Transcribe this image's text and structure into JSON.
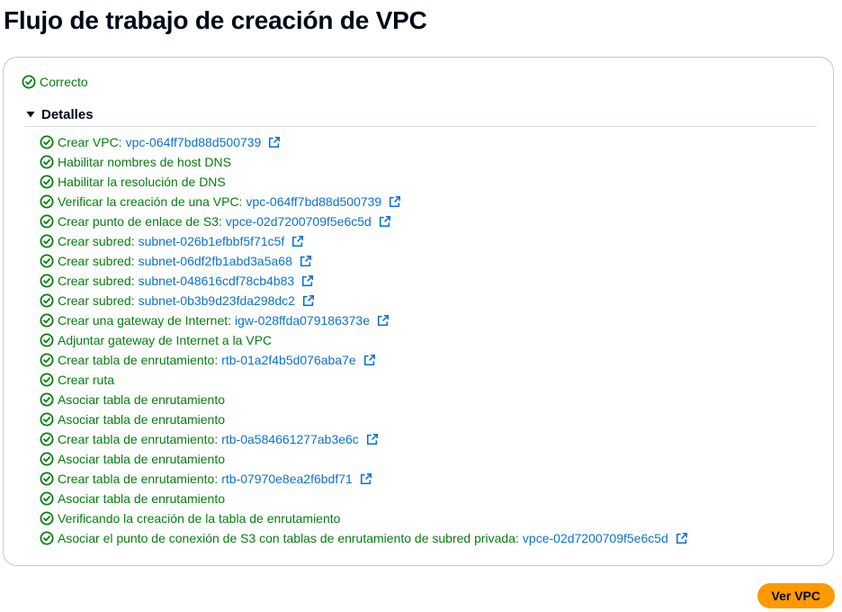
{
  "page": {
    "title": "Flujo de trabajo de creación de VPC"
  },
  "status": {
    "label": "Correcto",
    "color": "#037f0c",
    "icon": "check-circle-icon"
  },
  "details": {
    "title": "Detalles",
    "expanded": true,
    "icon": "caret-down-icon"
  },
  "steps": [
    {
      "label": "Crear VPC:",
      "link": "vpc-064ff7bd88d500739"
    },
    {
      "label": "Habilitar nombres de host DNS",
      "link": ""
    },
    {
      "label": "Habilitar la resolución de DNS",
      "link": ""
    },
    {
      "label": "Verificar la creación de una VPC:",
      "link": "vpc-064ff7bd88d500739"
    },
    {
      "label": "Crear punto de enlace de S3:",
      "link": "vpce-02d7200709f5e6c5d"
    },
    {
      "label": "Crear subred:",
      "link": "subnet-026b1efbbf5f71c5f"
    },
    {
      "label": "Crear subred:",
      "link": "subnet-06df2fb1abd3a5a68"
    },
    {
      "label": "Crear subred:",
      "link": "subnet-048616cdf78cb4b83"
    },
    {
      "label": "Crear subred:",
      "link": "subnet-0b3b9d23fda298dc2"
    },
    {
      "label": "Crear una gateway de Internet:",
      "link": "igw-028ffda079186373e"
    },
    {
      "label": "Adjuntar gateway de Internet a la VPC",
      "link": ""
    },
    {
      "label": "Crear tabla de enrutamiento:",
      "link": "rtb-01a2f4b5d076aba7e"
    },
    {
      "label": "Crear ruta",
      "link": ""
    },
    {
      "label": "Asociar tabla de enrutamiento",
      "link": ""
    },
    {
      "label": "Asociar tabla de enrutamiento",
      "link": ""
    },
    {
      "label": "Crear tabla de enrutamiento:",
      "link": "rtb-0a584661277ab3e6c"
    },
    {
      "label": "Asociar tabla de enrutamiento",
      "link": ""
    },
    {
      "label": "Crear tabla de enrutamiento:",
      "link": "rtb-07970e8ea2f6bdf71"
    },
    {
      "label": "Asociar tabla de enrutamiento",
      "link": ""
    },
    {
      "label": "Verificando la creación de la tabla de enrutamiento",
      "link": ""
    },
    {
      "label": "Asociar el punto de conexión de S3 con tablas de enrutamiento de subred privada:",
      "link": "vpce-02d7200709f5e6c5d"
    }
  ],
  "step_icon": "check-circle-icon",
  "link_icon": "external-link-icon",
  "colors": {
    "success": "#037f0c",
    "link": "#0972d3",
    "primary_button": "#ff9900"
  },
  "actions": {
    "view_vpc_label": "Ver VPC"
  }
}
